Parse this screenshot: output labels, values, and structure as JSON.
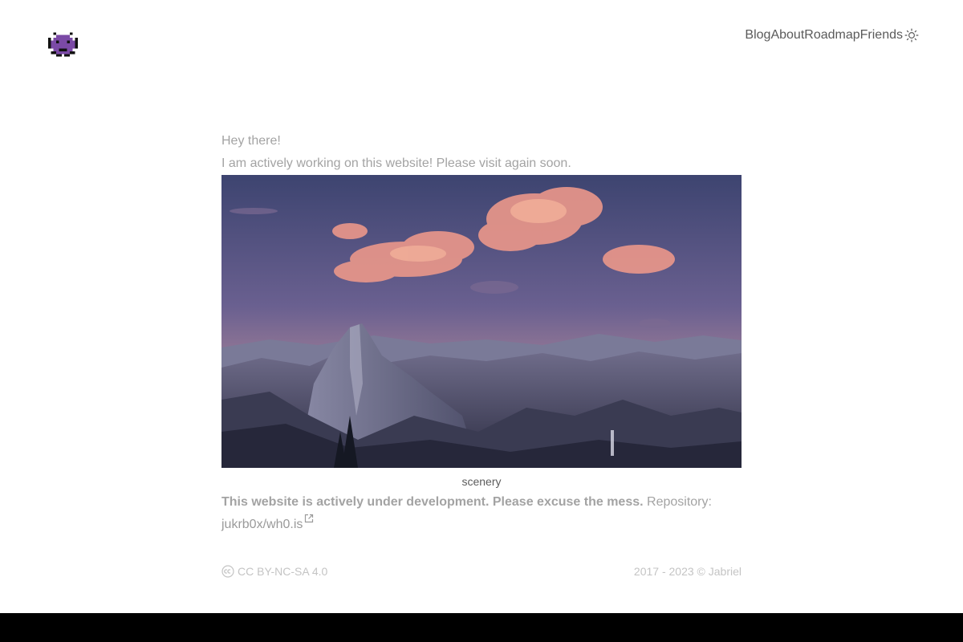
{
  "header": {
    "logo_icon": "space-invader-icon",
    "nav": [
      {
        "label": "Blog"
      },
      {
        "label": "About"
      },
      {
        "label": "Roadmap"
      },
      {
        "label": "Friends"
      }
    ],
    "theme_icon": "sun-icon"
  },
  "main": {
    "greeting": "Hey there!",
    "message": "I am actively working on this website! Please visit again soon.",
    "image_caption": "scenery",
    "notice_bold": "This website is actively under development. Please excuse the mess.",
    "repo_label": "Repository:",
    "repo_link": "jukrb0x/wh0.is",
    "repo_icon": "external-link-icon"
  },
  "footer": {
    "license": "CC BY-NC-SA 4.0",
    "license_icon": "creative-commons-icon",
    "copyright": "2017 - 2023 © Jabriel"
  },
  "colors": {
    "logo": "#7b4aa6",
    "nav_text": "#5a5a5a",
    "muted_text": "#a3a3a3",
    "bottom_bar": "#000000"
  }
}
